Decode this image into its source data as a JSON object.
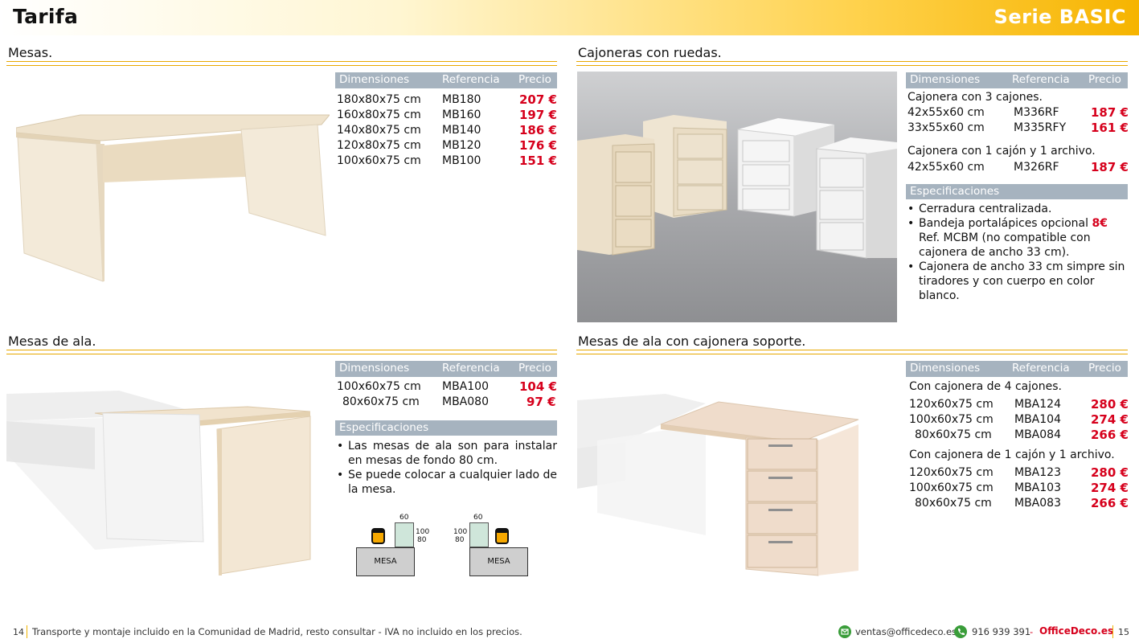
{
  "header": {
    "title": "Tarifa",
    "series": "Serie BASIC"
  },
  "mesas": {
    "title": "Mesas.",
    "columns": [
      "Dimensiones",
      "Referencia",
      "Precio"
    ],
    "rows": [
      {
        "dim": "180x80x75 cm",
        "ref": "MB180",
        "price": "207 €"
      },
      {
        "dim": "160x80x75 cm",
        "ref": "MB160",
        "price": "197 €"
      },
      {
        "dim": "140x80x75 cm",
        "ref": "MB140",
        "price": "186 €"
      },
      {
        "dim": "120x80x75 cm",
        "ref": "MB120",
        "price": "176 €"
      },
      {
        "dim": "100x60x75 cm",
        "ref": "MB100",
        "price": "151 €"
      }
    ]
  },
  "cajoneras": {
    "title": "Cajoneras con ruedas.",
    "columns": [
      "Dimensiones",
      "Referencia",
      "Precio"
    ],
    "group1": "Cajonera con 3 cajones.",
    "rows1": [
      {
        "dim": "42x55x60 cm",
        "ref": "M336RF",
        "price": "187 €"
      },
      {
        "dim": "33x55x60 cm",
        "ref": "M335RFY",
        "price": "161 €"
      }
    ],
    "group2": "Cajonera con 1 cajón y 1 archivo.",
    "rows2": [
      {
        "dim": "42x55x60 cm",
        "ref": "M326RF",
        "price": "187 €"
      }
    ],
    "spec_title": "Especificaciones",
    "spec": {
      "s1": "Cerradura centralizada.",
      "s2_pre": "Bandeja portalápices opcional ",
      "s2_price": "8€",
      "s2_l2": "Ref. MCBM (no compatible con",
      "s2_l3": "cajonera de ancho 33 cm).",
      "s3_l1": "Cajonera de ancho 33 cm simpre sin",
      "s3_l2": "tiradores y con cuerpo en color blanco."
    }
  },
  "mesas_ala": {
    "title": "Mesas de ala.",
    "columns": [
      "Dimensiones",
      "Referencia",
      "Precio"
    ],
    "rows": [
      {
        "dim": "100x60x75 cm",
        "ref": "MBA100",
        "price": "104 €"
      },
      {
        "dim": "80x60x75 cm",
        "ref": "MBA080",
        "price": "97 €"
      }
    ],
    "spec_title": "Especificaciones",
    "spec": {
      "s1": "Las mesas de ala son para instalar en mesas de fondo 80 cm.",
      "s2": "Se puede colocar a cualquier lado de la mesa."
    },
    "diagram": {
      "w": "60",
      "d1": "100",
      "d2": "80",
      "mesa": "MESA"
    }
  },
  "ala_cajonera": {
    "title": "Mesas de ala con cajonera soporte.",
    "columns": [
      "Dimensiones",
      "Referencia",
      "Precio"
    ],
    "group1": "Con cajonera de 4 cajones.",
    "rows1": [
      {
        "dim": "120x60x75 cm",
        "ref": "MBA124",
        "price": "280 €"
      },
      {
        "dim": "100x60x75 cm",
        "ref": "MBA104",
        "price": "274 €"
      },
      {
        "dim": "80x60x75 cm",
        "ref": "MBA084",
        "price": "266 €"
      }
    ],
    "group2": "Con cajonera de 1 cajón y 1 archivo.",
    "rows2": [
      {
        "dim": "120x60x75 cm",
        "ref": "MBA123",
        "price": "280 €"
      },
      {
        "dim": "100x60x75 cm",
        "ref": "MBA103",
        "price": "274 €"
      },
      {
        "dim": "80x60x75 cm",
        "ref": "MBA083",
        "price": "266 €"
      }
    ]
  },
  "footer": {
    "page_left": "14",
    "note": "Transporte y montaje incluido en la Comunidad de Madrid, resto consultar - IVA no incluido en los precios.",
    "email": "ventas@officedeco.es",
    "phone": "916 939 391",
    "dash": "-",
    "brand": "OfficeDeco.es",
    "page_right": "15"
  },
  "colors": {
    "accent": "#f6b400",
    "price": "#d6001c",
    "table_head": "#a6b3bf"
  }
}
